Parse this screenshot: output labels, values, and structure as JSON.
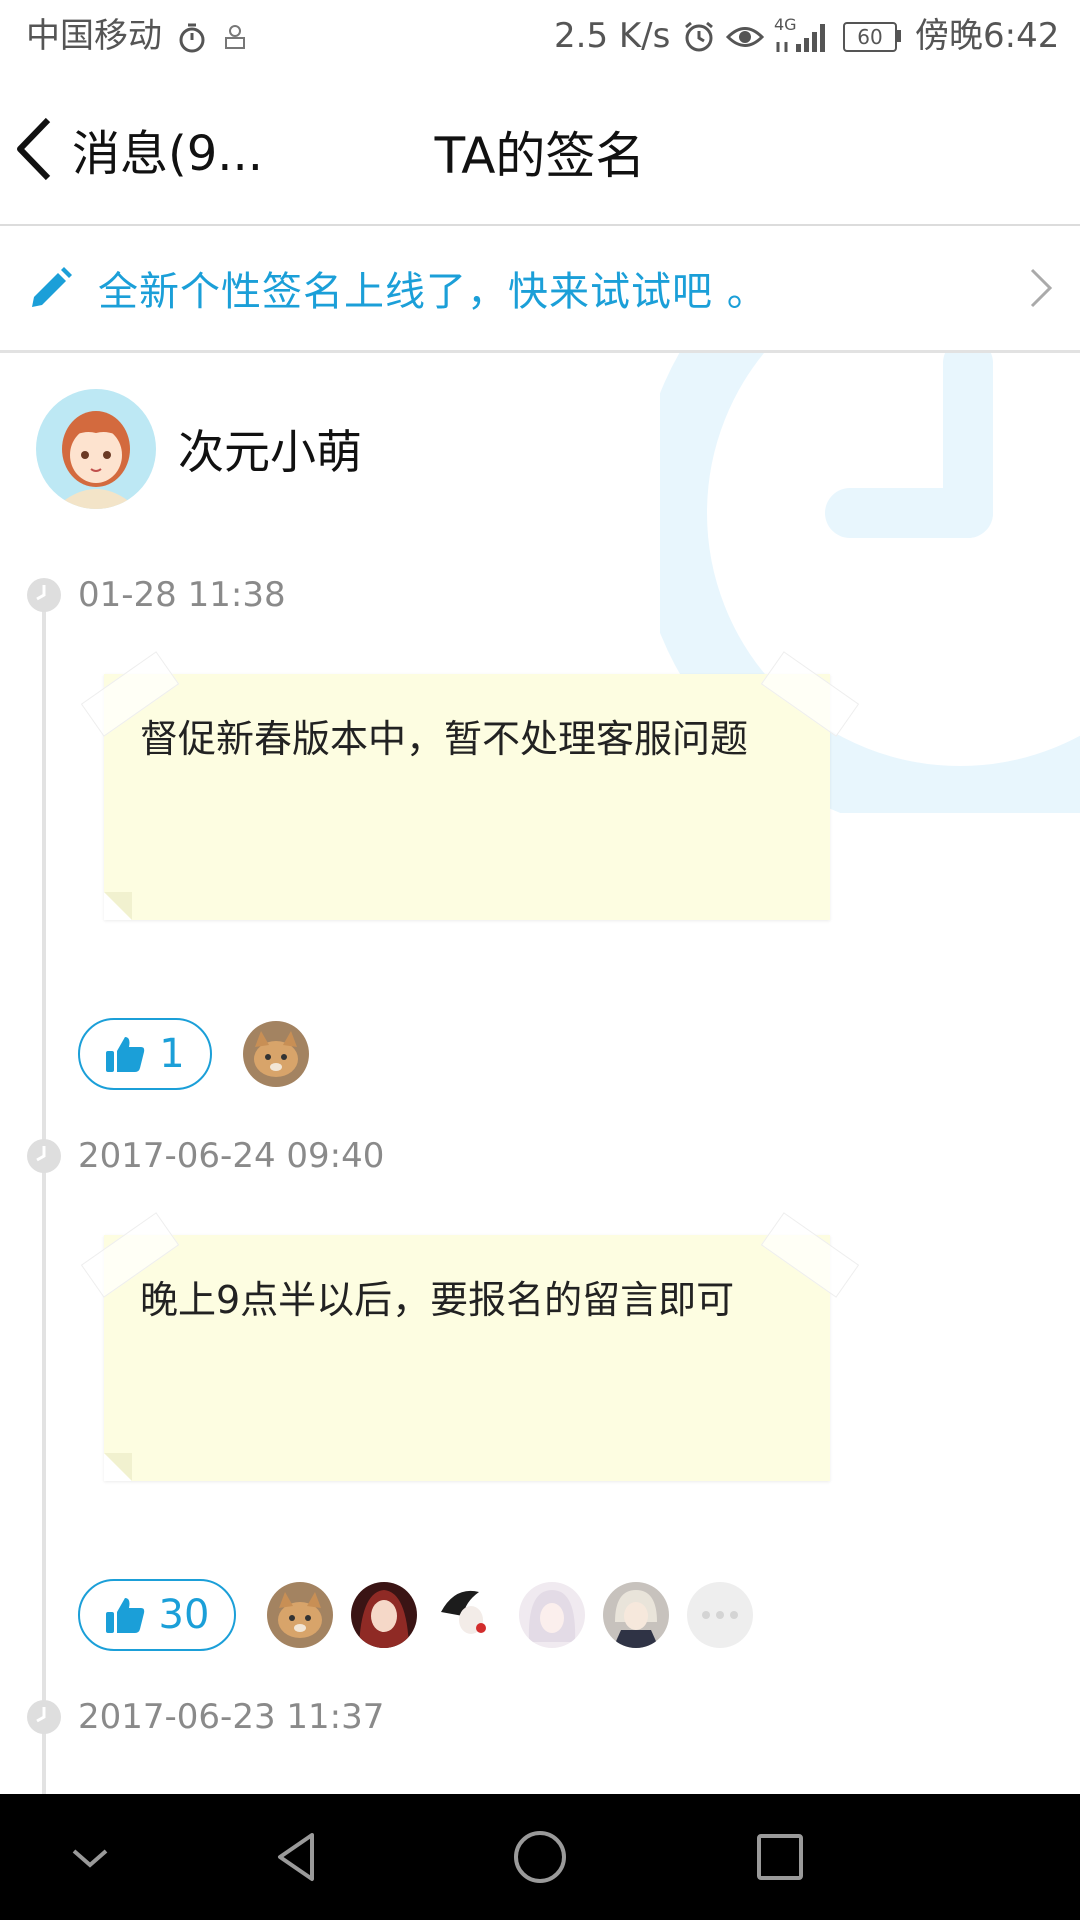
{
  "status_bar": {
    "carrier": "中国移动",
    "net_speed": "2.5 K/s",
    "signal_label": "4G",
    "battery": "60",
    "time": "傍晚6:42"
  },
  "nav": {
    "back_label": "消息(9...",
    "title": "TA的签名"
  },
  "banner": {
    "text": "全新个性签名上线了，快来试试吧 。"
  },
  "profile": {
    "nickname": "次元小萌"
  },
  "signatures": [
    {
      "time": "01-28 11:38",
      "text": "督促新春版本中，暂不处理客服问题",
      "likes": "1"
    },
    {
      "time": "2017-06-24 09:40",
      "text": "晚上9点半以后，要报名的留言即可",
      "likes": "30"
    },
    {
      "time": "2017-06-23 11:37"
    }
  ],
  "colors": {
    "accent": "#1b9fd8",
    "note_bg": "#fdfde1",
    "timeline": "#e2e2e2",
    "deco_clock": "#e8f6fd"
  },
  "icons": [
    "pencil-icon",
    "chevron-right-icon",
    "thumbs-up-icon",
    "clock-icon",
    "more-dots-icon",
    "back-triangle-icon",
    "home-circle-icon",
    "recent-square-icon",
    "collapse-chevron-icon"
  ]
}
